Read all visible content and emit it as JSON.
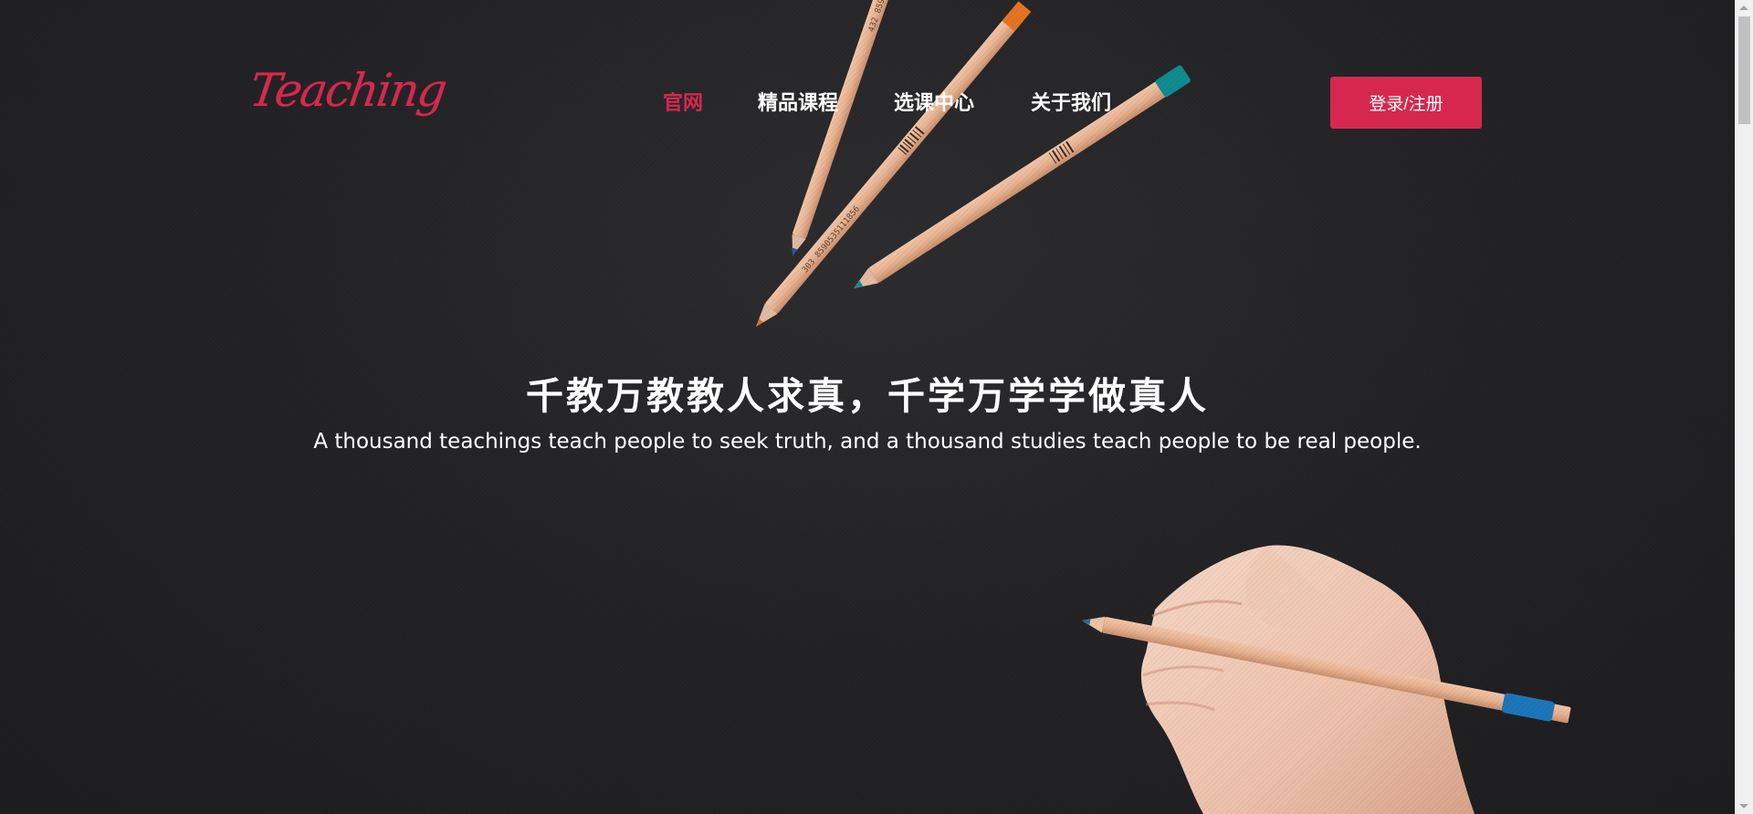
{
  "header": {
    "logo_text": "Teaching",
    "nav": [
      {
        "label": "官网",
        "active": true
      },
      {
        "label": "精品课程",
        "active": false
      },
      {
        "label": "选课中心",
        "active": false
      },
      {
        "label": "关于我们",
        "active": false
      }
    ],
    "login_label": "登录/注册"
  },
  "hero": {
    "title": "千教万教教人求真，千学万学学做真人",
    "subtitle": "A thousand teachings teach people to seek truth, and a thousand studies teach people to be real people."
  },
  "colors": {
    "accent": "#d6284f",
    "background": "#1f1f21",
    "text": "#ffffff"
  },
  "icons": [
    "scroll-up-arrow-icon",
    "scroll-down-arrow-icon"
  ]
}
